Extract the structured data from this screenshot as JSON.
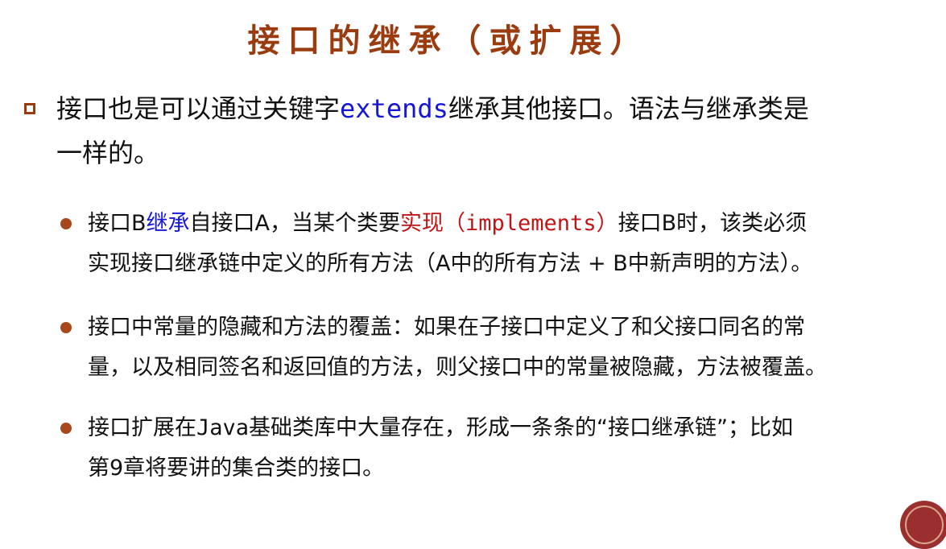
{
  "title": "接口的继承（或扩展）",
  "main_bullet": {
    "text_before": "接口也是可以通过关键字",
    "keyword": "extends",
    "text_after_line1": "继承其他接口。语法与继承类是",
    "text_line2": "一样的。"
  },
  "sub_bullets": [
    {
      "line1_a": "接口B",
      "line1_blue": "继承",
      "line1_b": "自接口A，当某个类要",
      "line1_red": "实现（",
      "line1_red_code": "implements",
      "line1_red_end": "）",
      "line1_c": "接口B时，该类必须",
      "line2": "实现接口继承链中定义的所有方法（A中的所有方法 + B中新声明的方法）。"
    },
    {
      "line1": "接口中常量的隐藏和方法的覆盖：如果在子接口中定义了和父接口同名的常",
      "line2": "量，以及相同签名和返回值的方法，则父接口中的常量被隐藏，方法被覆盖。"
    },
    {
      "line1_a": "接口扩展在",
      "line1_code": "Java",
      "line1_b": "基础类库中大量存在，形成一条条的“接口继承链”；比如",
      "line2": "第9章将要讲的集合类的接口。"
    }
  ],
  "colors": {
    "title": "#9b3b10",
    "bullet": "#9b3b10",
    "keyword_blue": "#1616d8",
    "highlight_red": "#c21414"
  }
}
